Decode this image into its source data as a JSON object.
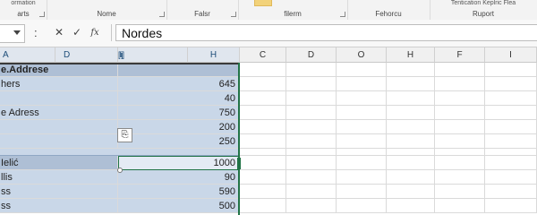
{
  "ribbon": {
    "groups": [
      {
        "label": "arts",
        "top": "ormation"
      },
      {
        "label": "Nome",
        "top": ""
      },
      {
        "label": "Falsr",
        "top": ""
      },
      {
        "label": "filerm",
        "top": ""
      },
      {
        "label": "Fehorcu",
        "top": ""
      },
      {
        "label": "Ruport",
        "top": "Tentication    Keplric    Flea"
      }
    ]
  },
  "formula_bar": {
    "cancel_icon": "✕",
    "enter_icon": "✓",
    "fx_icon": "fx",
    "value": "Nordes"
  },
  "columns": [
    "A",
    "D",
    "[lij]",
    "H",
    "C",
    "D",
    "O",
    "H",
    "F",
    "I"
  ],
  "rows": [
    {
      "a": "e.Addrese",
      "h": "",
      "style": "header"
    },
    {
      "a": "hers",
      "h": "645"
    },
    {
      "a": "",
      "h": "40"
    },
    {
      "a": "e Adress",
      "h": "750"
    },
    {
      "a": "",
      "h": "200"
    },
    {
      "a": "",
      "h": "250"
    },
    {
      "a": "Ielić",
      "h": "1000",
      "style": "active"
    },
    {
      "a": "llis",
      "h": "90"
    },
    {
      "a": "ss",
      "h": "590"
    },
    {
      "a": "ss",
      "h": "500"
    }
  ],
  "paste_options_icon": "clipboard-icon",
  "colors": {
    "accent": "#217346",
    "selection": "#c9d7e8"
  }
}
